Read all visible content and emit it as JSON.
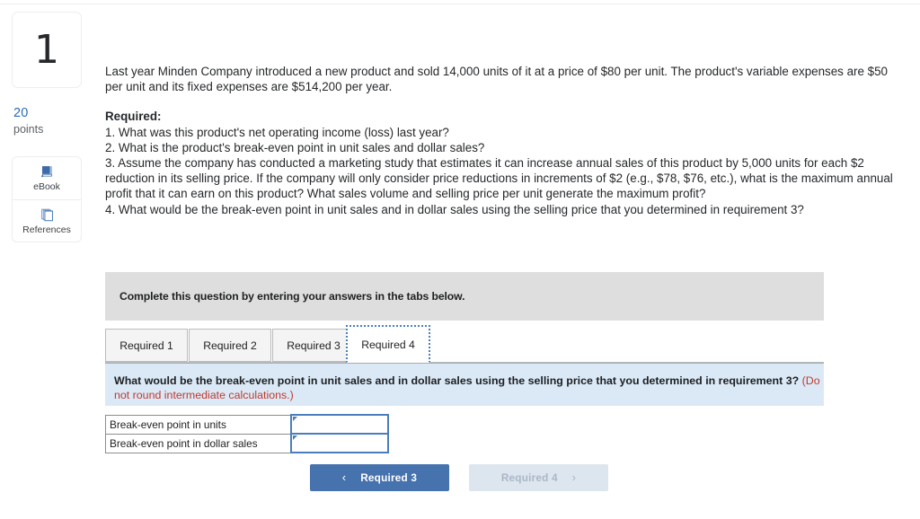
{
  "question": {
    "number": "1",
    "points_value": "20",
    "points_label": "points"
  },
  "tools": [
    {
      "label": "eBook",
      "icon": "book-icon"
    },
    {
      "label": "References",
      "icon": "pages-stack-icon"
    }
  ],
  "prompt": {
    "intro": "Last year Minden Company introduced a new product and sold 14,000 units of it at a price of $80 per unit. The product's variable expenses are $50 per unit and its fixed expenses are $514,200 per year.",
    "required_heading": "Required:",
    "requirements": [
      "1. What was this product's net operating income (loss) last year?",
      "2. What is the product's break-even point in unit sales and dollar sales?",
      "3. Assume the company has conducted a marketing study that estimates it can increase annual sales of this product by 5,000 units for each $2 reduction in its selling price. If the company will only consider price reductions in increments of $2 (e.g., $78, $76, etc.), what is the maximum annual profit that it can earn on this product? What sales volume and selling price per unit generate the maximum profit?",
      "4. What would be the break-even point in unit sales and in dollar sales using the selling price that you determined in requirement 3?"
    ]
  },
  "instruction_bar": {
    "text": "Complete this question by entering your answers in the tabs below."
  },
  "tabs": [
    {
      "label": "Required 1",
      "active": false
    },
    {
      "label": "Required 2",
      "active": false
    },
    {
      "label": "Required 3",
      "active": false
    },
    {
      "label": "Required 4",
      "active": true
    }
  ],
  "sub_question": {
    "text": "What would be the break-even point in unit sales and in dollar sales using the selling price that you determined in requirement 3?",
    "note": "(Do not round intermediate calculations.)"
  },
  "answer_table": {
    "rows": [
      {
        "label": "Break-even point in units",
        "value": "",
        "placeholder": ""
      },
      {
        "label": "Break-even point in dollar sales",
        "value": "",
        "placeholder": ""
      }
    ]
  },
  "nav": {
    "prev_label": "Required 3",
    "prev_chevron": "‹",
    "next_label": "Required 4",
    "next_chevron": "›"
  },
  "colors": {
    "accent_blue": "#4672ad",
    "tab_border_blue": "#4a7ebb",
    "panel_blue": "#dbe9f7",
    "instruction_gray": "#dedede",
    "note_red": "#c0392b",
    "points_blue": "#2b6cb5"
  }
}
